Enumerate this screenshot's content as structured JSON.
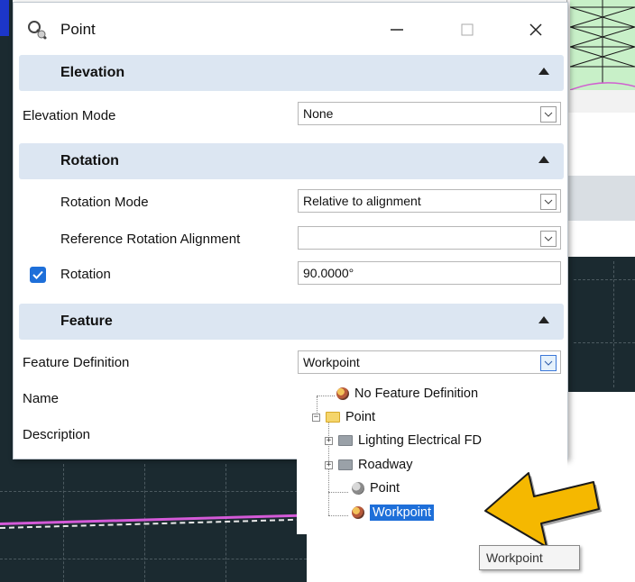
{
  "window": {
    "title": "Point",
    "icon": "point-tool-icon",
    "minimize_glyph": "—",
    "maximize_glyph": "☐",
    "close_glyph": "✕"
  },
  "sections": {
    "elevation": {
      "title": "Elevation",
      "fields": {
        "elevation_mode": {
          "label": "Elevation Mode",
          "value": "None"
        }
      }
    },
    "rotation": {
      "title": "Rotation",
      "fields": {
        "rotation_mode": {
          "label": "Rotation Mode",
          "value": "Relative to alignment"
        },
        "reference_rotation_alignment": {
          "label": "Reference Rotation Alignment",
          "value": ""
        },
        "rotation": {
          "label": "Rotation",
          "value": "90.0000°",
          "checked": true
        }
      }
    },
    "feature": {
      "title": "Feature",
      "fields": {
        "feature_definition": {
          "label": "Feature Definition",
          "value": "Workpoint"
        },
        "name": {
          "label": "Name"
        },
        "description": {
          "label": "Description"
        }
      }
    }
  },
  "feature_tree": {
    "items": [
      {
        "label": "No Feature Definition",
        "icon": "feature-icon"
      },
      {
        "label": "Point",
        "icon": "folder-open-icon",
        "expanded": true
      },
      {
        "label": "Lighting Electrical FD",
        "icon": "folder-icon",
        "expanded": false
      },
      {
        "label": "Roadway",
        "icon": "folder-icon",
        "expanded": false
      },
      {
        "label": "Point",
        "icon": "feature-icon"
      },
      {
        "label": "Workpoint",
        "icon": "feature-icon",
        "selected": true
      }
    ]
  },
  "tooltip": {
    "text": "Workpoint"
  },
  "colors": {
    "section_header_bg": "#dce6f2",
    "selection": "#1e6fd9",
    "callout_arrow": "#f5b800",
    "canvas_dark": "#1b2a30"
  }
}
